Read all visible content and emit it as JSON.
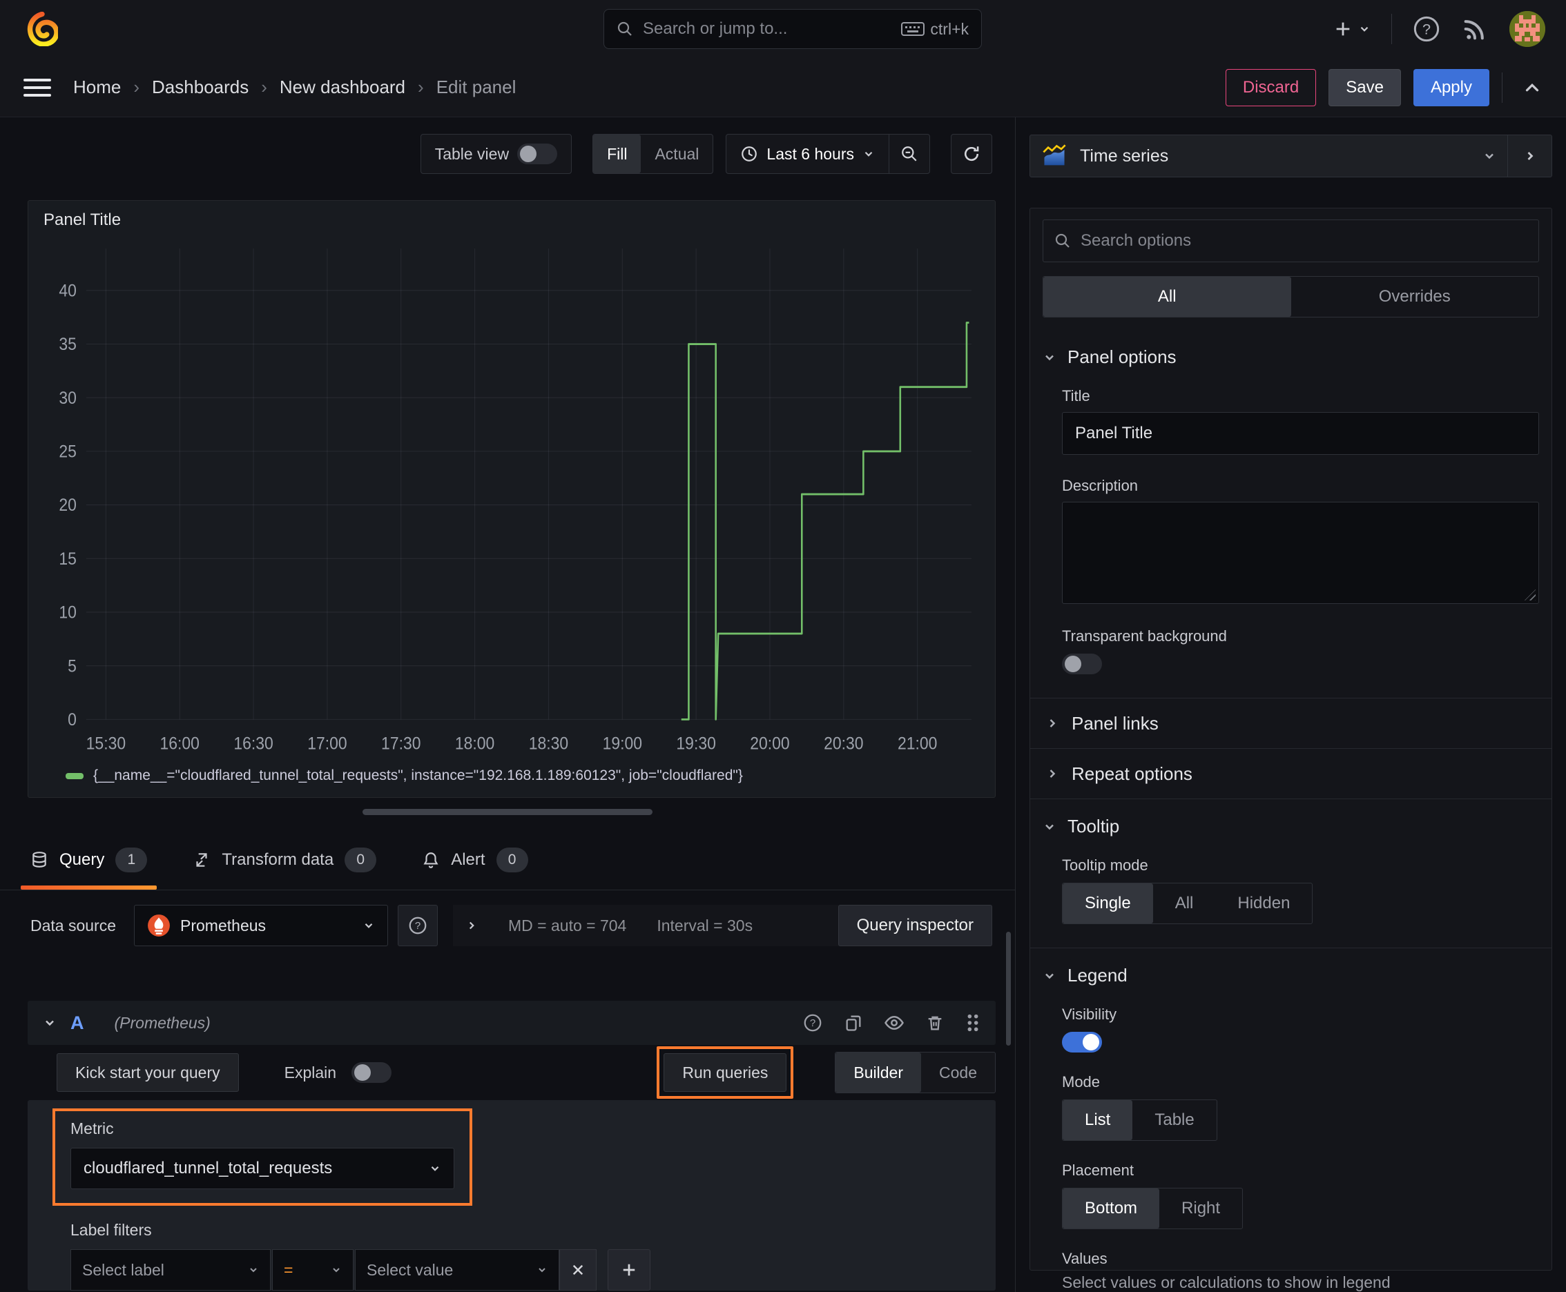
{
  "topbar": {
    "search_placeholder": "Search or jump to...",
    "shortcut": "ctrl+k"
  },
  "breadcrumb": {
    "items": [
      "Home",
      "Dashboards",
      "New dashboard",
      "Edit panel"
    ],
    "discard": "Discard",
    "save": "Save",
    "apply": "Apply"
  },
  "toolbar": {
    "table_view": "Table view",
    "fill": "Fill",
    "actual": "Actual",
    "time_range": "Last 6 hours"
  },
  "panel": {
    "title": "Panel Title"
  },
  "chart_data": {
    "type": "line",
    "title": "Panel Title",
    "x_ticks": [
      "15:30",
      "16:00",
      "16:30",
      "17:00",
      "17:30",
      "18:00",
      "18:30",
      "19:00",
      "19:30",
      "20:00",
      "20:30",
      "21:00"
    ],
    "y_ticks": [
      0,
      5,
      10,
      15,
      20,
      25,
      30,
      35,
      40
    ],
    "ylim": [
      0,
      40
    ],
    "x_range": [
      "15:22",
      "21:22"
    ],
    "grid": true,
    "legend_position": "bottom",
    "series": [
      {
        "name": "{__name__=\"cloudflared_tunnel_total_requests\", instance=\"192.168.1.189:60123\", job=\"cloudflared\"}",
        "color": "#73bf69",
        "points": [
          [
            "19:24",
            0
          ],
          [
            "19:27",
            0
          ],
          [
            "19:27",
            35
          ],
          [
            "19:38",
            35
          ],
          [
            "19:38",
            0
          ],
          [
            "19:39",
            8
          ],
          [
            "20:13",
            8
          ],
          [
            "20:13",
            21
          ],
          [
            "20:38",
            21
          ],
          [
            "20:38",
            25
          ],
          [
            "20:53",
            25
          ],
          [
            "20:53",
            31
          ],
          [
            "21:20",
            31
          ],
          [
            "21:20",
            37
          ],
          [
            "21:21",
            37
          ]
        ]
      }
    ]
  },
  "query_section": {
    "tabs": [
      {
        "label": "Query",
        "count": "1"
      },
      {
        "label": "Transform data",
        "count": "0"
      },
      {
        "label": "Alert",
        "count": "0"
      }
    ],
    "datasource_label": "Data source",
    "datasource": "Prometheus",
    "stats_md": "MD = auto = 704",
    "stats_interval": "Interval = 30s",
    "inspector": "Query inspector",
    "row_ref": "A",
    "row_ds": "(Prometheus)",
    "kick_start": "Kick start your query",
    "explain": "Explain",
    "run_queries": "Run queries",
    "builder": "Builder",
    "code": "Code",
    "metric_label": "Metric",
    "metric_value": "cloudflared_tunnel_total_requests",
    "label_filters": "Label filters",
    "select_label": "Select label",
    "operator": "=",
    "select_value": "Select value",
    "remove": "x",
    "add": "+"
  },
  "options": {
    "viz_type": "Time series",
    "search_placeholder": "Search options",
    "tab_all": "All",
    "tab_overrides": "Overrides",
    "panel_options": "Panel options",
    "title_label": "Title",
    "title_value": "Panel Title",
    "description_label": "Description",
    "transparent_label": "Transparent background",
    "panel_links": "Panel links",
    "repeat_options": "Repeat options",
    "tooltip": "Tooltip",
    "tooltip_mode": "Tooltip mode",
    "tt_single": "Single",
    "tt_all": "All",
    "tt_hidden": "Hidden",
    "legend": "Legend",
    "visibility": "Visibility",
    "mode": "Mode",
    "mode_list": "List",
    "mode_table": "Table",
    "placement": "Placement",
    "placement_bottom": "Bottom",
    "placement_right": "Right",
    "values": "Values",
    "values_help": "Select values or calculations to show in legend"
  },
  "colors": {
    "accent_blue": "#3d71d9",
    "annotation_orange": "#ff7b2f",
    "series_green": "#73bf69",
    "discard_pink": "#e8457c"
  }
}
